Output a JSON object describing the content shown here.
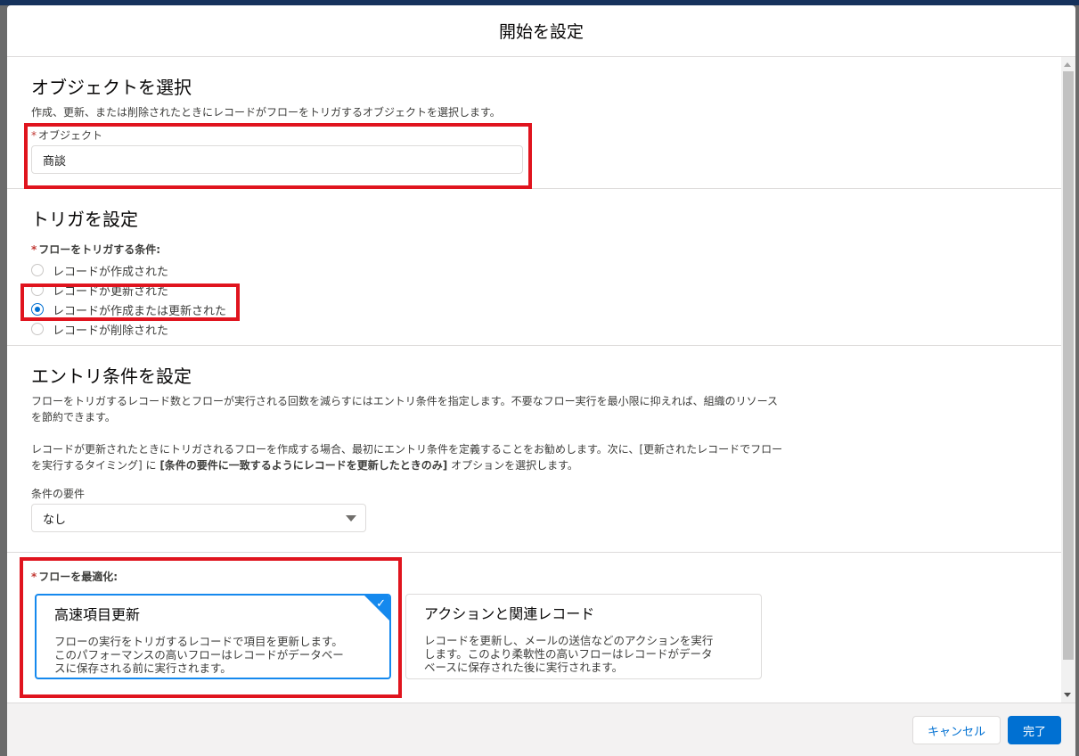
{
  "modal": {
    "title": "開始を設定"
  },
  "object_section": {
    "title": "オブジェクトを選択",
    "description": "作成、更新、または削除されたときにレコードがフローをトリガするオブジェクトを選択します。",
    "field_required": "*",
    "field_label": "オブジェクト",
    "field_value": "商談"
  },
  "trigger_section": {
    "title": "トリガを設定",
    "label_required": "*",
    "label": "フローをトリガする条件:",
    "options": [
      {
        "label": "レコードが作成された",
        "selected": false
      },
      {
        "label": "レコードが更新された",
        "selected": false
      },
      {
        "label": "レコードが作成または更新された",
        "selected": true
      },
      {
        "label": "レコードが削除された",
        "selected": false
      }
    ]
  },
  "entry_section": {
    "title": "エントリ条件を設定",
    "desc1": "フローをトリガするレコード数とフローが実行される回数を減らすにはエントリ条件を指定します。不要なフロー実行を最小限に抑えれば、組織のリソース",
    "desc1b": "を節約できます。",
    "desc2a": "レコードが更新されたときにトリガされるフローを作成する場合、最初にエントリ条件を定義することをお勧めします。次に、[更新されたレコードでフロー",
    "desc2b_pre": "を実行するタイミング] に ",
    "desc2b_bold": "[条件の要件に一致するようにレコードを更新したときのみ]",
    "desc2b_post": " オプションを選択します。",
    "requirement_label": "条件の要件",
    "requirement_value": "なし"
  },
  "optimize_section": {
    "label_required": "*",
    "label": "フローを最適化:",
    "cards": [
      {
        "title": "高速項目更新",
        "line1": "フローの実行をトリガするレコードで項目を更新します。",
        "line2": "このパフォーマンスの高いフローはレコードがデータベー",
        "line3": "スに保存される前に実行されます。",
        "selected": true
      },
      {
        "title": "アクションと関連レコード",
        "line1": "レコードを更新し、メールの送信などのアクションを実行",
        "line2": "します。このより柔軟性の高いフローはレコードがデータ",
        "line3": "ベースに保存された後に実行されます。",
        "selected": false
      }
    ]
  },
  "footer": {
    "cancel_label": "キャンセル",
    "done_label": "完了"
  },
  "colors": {
    "brand": "#0070d2",
    "highlight": "#e0141e",
    "selected_border": "#1589ee"
  }
}
